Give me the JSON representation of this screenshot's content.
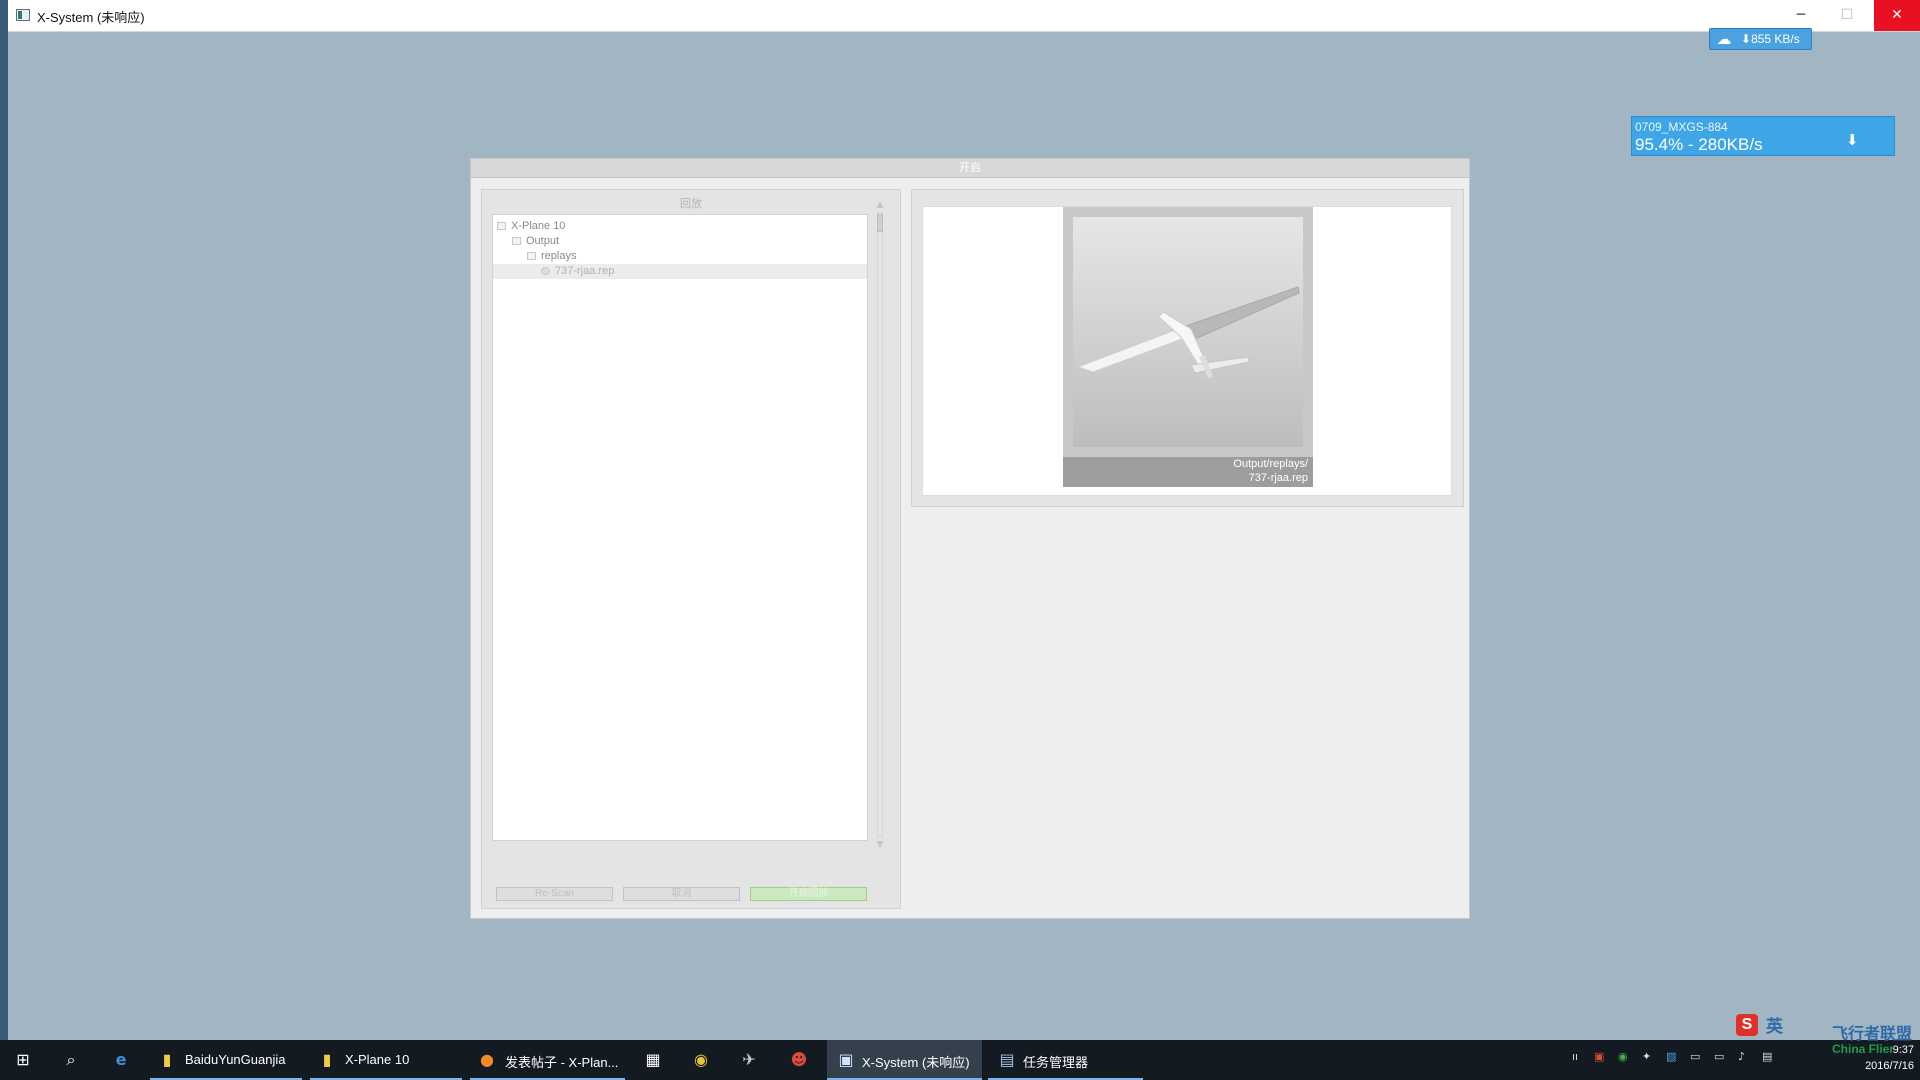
{
  "window": {
    "title": "X-System (未响应)",
    "controls": {
      "minimize": "─",
      "maximize": "☐",
      "close": "✕"
    }
  },
  "speed_widget": {
    "icon": "cloud-icon",
    "icon_glyph": "☁",
    "speed": "855 KB/s",
    "arrow": "⬇"
  },
  "download_widget": {
    "name": "0709_MXGS-884",
    "progress": "95.4% - 280KB/s",
    "progress_value": 0.954,
    "arrow": "⬇"
  },
  "dialog": {
    "title": "开启",
    "left_panel": {
      "title": "回放",
      "tree": [
        {
          "label": "X-Plane 10",
          "level": 0
        },
        {
          "label": "Output",
          "level": 1
        },
        {
          "label": "replays",
          "level": 2
        },
        {
          "label": "737-rjaa.rep",
          "level": 3,
          "selected": true
        }
      ],
      "buttons": {
        "rescan": "Re-Scan",
        "cancel": "取消",
        "open": "开启回放"
      }
    },
    "preview": {
      "caption_line1": "Output/replays/",
      "caption_line2": "737-rjaa.rep"
    }
  },
  "taskbar": {
    "items": [
      {
        "label": "BaiduYunGuanjia",
        "icon": "folder-icon"
      },
      {
        "label": "X-Plane 10",
        "icon": "folder-icon"
      },
      {
        "label": "发表帖子 - X-Plan...",
        "icon": "firefox-icon"
      },
      {
        "label": "X-System (未响应)",
        "icon": "xsystem-icon"
      },
      {
        "label": "任务管理器",
        "icon": "task-manager-icon"
      }
    ],
    "clock_time": "9:37",
    "clock_date": "2016/7/16"
  },
  "watermark": {
    "text": "飞行者联盟",
    "sub": "China Flier",
    "badge": "S",
    "badge2": "英"
  },
  "colors": {
    "desktop": "#a2b5c3",
    "close": "#e81123",
    "accent": "#3ea6e6",
    "taskbar": "#141a21"
  }
}
